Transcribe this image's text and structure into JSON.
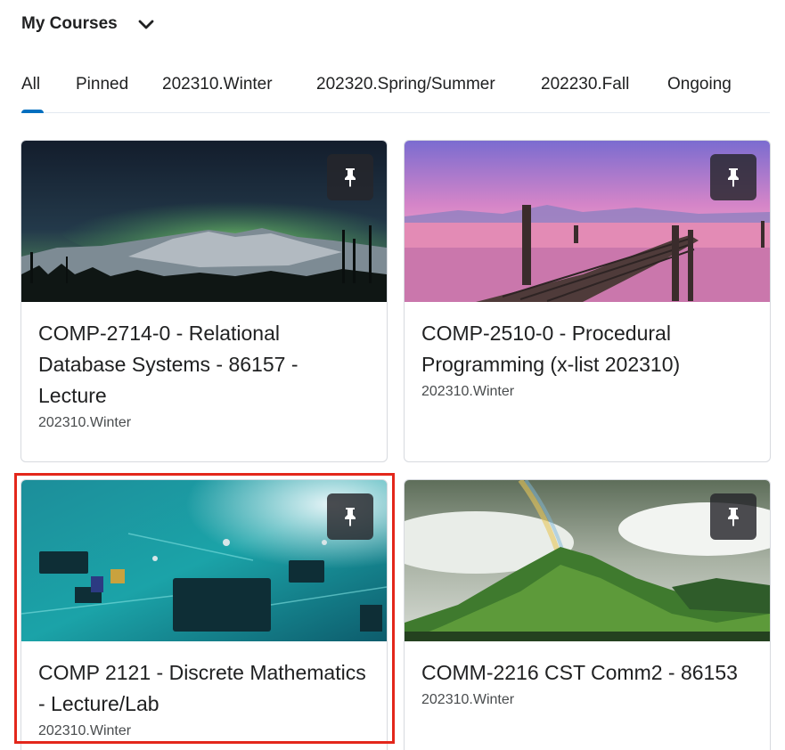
{
  "header": {
    "title": "My Courses",
    "toggle_icon": "chevron-down-icon"
  },
  "tabs": [
    {
      "label": "All",
      "selected": true
    },
    {
      "label": "Pinned",
      "selected": false
    },
    {
      "label": "202310.Winter",
      "selected": false
    },
    {
      "label": "202320.Spring/Summer",
      "selected": false
    },
    {
      "label": "202230.Fall",
      "selected": false
    },
    {
      "label": "Ongoing",
      "selected": false
    }
  ],
  "accent_color": "#006fbf",
  "highlight_color": "#e3271b",
  "courses": [
    {
      "title": "COMP-2714-0 - Relational Database Systems - 86157 - Lecture",
      "term": "202310.Winter",
      "image": "aurora-over-mountains",
      "pin_icon": "pin-icon"
    },
    {
      "title": "COMP-2510-0 - Procedural Programming (x-list 202310)",
      "term": "202310.Winter",
      "image": "pier-at-pink-sunset",
      "pin_icon": "pin-icon"
    },
    {
      "title": "COMP 2121 - Discrete Mathematics - Lecture/Lab",
      "term": "202310.Winter",
      "image": "circuit-board",
      "pin_icon": "pin-icon",
      "highlighted": true
    },
    {
      "title": "COMM-2216 CST Comm2 - 86153",
      "term": "202310.Winter",
      "image": "green-mountain-rainbow",
      "pin_icon": "pin-icon"
    }
  ]
}
